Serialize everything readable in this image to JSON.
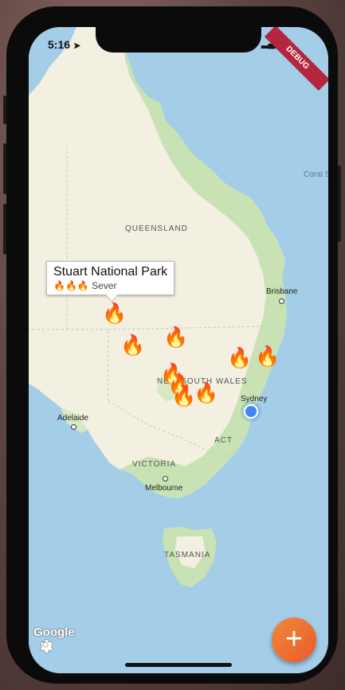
{
  "status_bar": {
    "time": "5:16",
    "location_icon": "location-arrow-icon"
  },
  "debug_banner": "DEBUG",
  "map": {
    "region_labels": [
      "QUEENSLAND",
      "NEW SOUTH WALES",
      "VICTORIA",
      "TASMANIA",
      "ACT"
    ],
    "ocean_label": "Coral Sea",
    "cities": [
      "Brisbane",
      "Sydney",
      "Adelaide",
      "Melbourne"
    ]
  },
  "info_window": {
    "title": "Stuart National Park",
    "severity_text": "Sever",
    "severity_icons": "🔥🔥🔥"
  },
  "fire_icon": "🔥",
  "google_logo": "Google",
  "fab_label": "+",
  "colors": {
    "water": "#a4cde8",
    "land": "#f3efe1",
    "vegetation": "#c9e2b3",
    "fab": "#ee6b30",
    "debug_banner": "#b3263d",
    "location_dot": "#4285f4"
  }
}
